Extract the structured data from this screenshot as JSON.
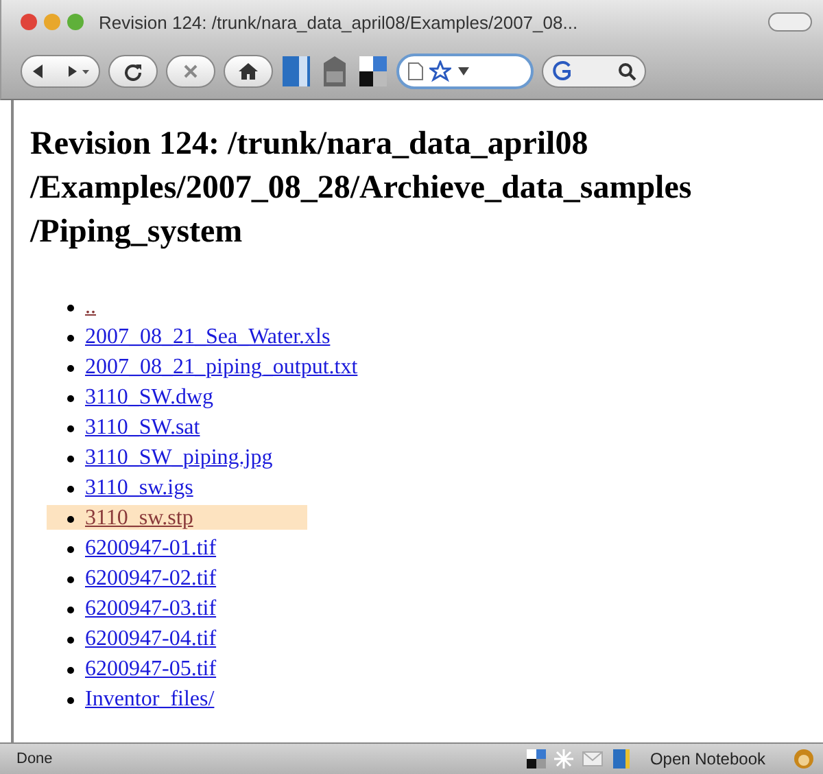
{
  "window": {
    "title": "Revision 124: /trunk/nara_data_april08/Examples/2007_08..."
  },
  "page": {
    "heading": "Revision 124: /trunk/nara_data_april08 /Examples/2007_08_28/Archieve_data_samples /Piping_system",
    "items": [
      {
        "label": "..",
        "visited": true,
        "selected": false
      },
      {
        "label": "2007_08_21_Sea_Water.xls",
        "visited": false,
        "selected": false
      },
      {
        "label": "2007_08_21_piping_output.txt",
        "visited": false,
        "selected": false
      },
      {
        "label": "3110_SW.dwg",
        "visited": false,
        "selected": false
      },
      {
        "label": "3110_SW.sat",
        "visited": false,
        "selected": false
      },
      {
        "label": "3110_SW_piping.jpg",
        "visited": false,
        "selected": false
      },
      {
        "label": "3110_sw.igs",
        "visited": false,
        "selected": false
      },
      {
        "label": "3110_sw.stp",
        "visited": true,
        "selected": true
      },
      {
        "label": "6200947-01.tif",
        "visited": false,
        "selected": false
      },
      {
        "label": "6200947-02.tif",
        "visited": false,
        "selected": false
      },
      {
        "label": "6200947-03.tif",
        "visited": false,
        "selected": false
      },
      {
        "label": "6200947-04.tif",
        "visited": false,
        "selected": false
      },
      {
        "label": "6200947-05.tif",
        "visited": false,
        "selected": false
      },
      {
        "label": "Inventor_files/",
        "visited": false,
        "selected": false
      }
    ]
  },
  "status_bar": {
    "text": "Done",
    "notebook": "Open Notebook"
  }
}
